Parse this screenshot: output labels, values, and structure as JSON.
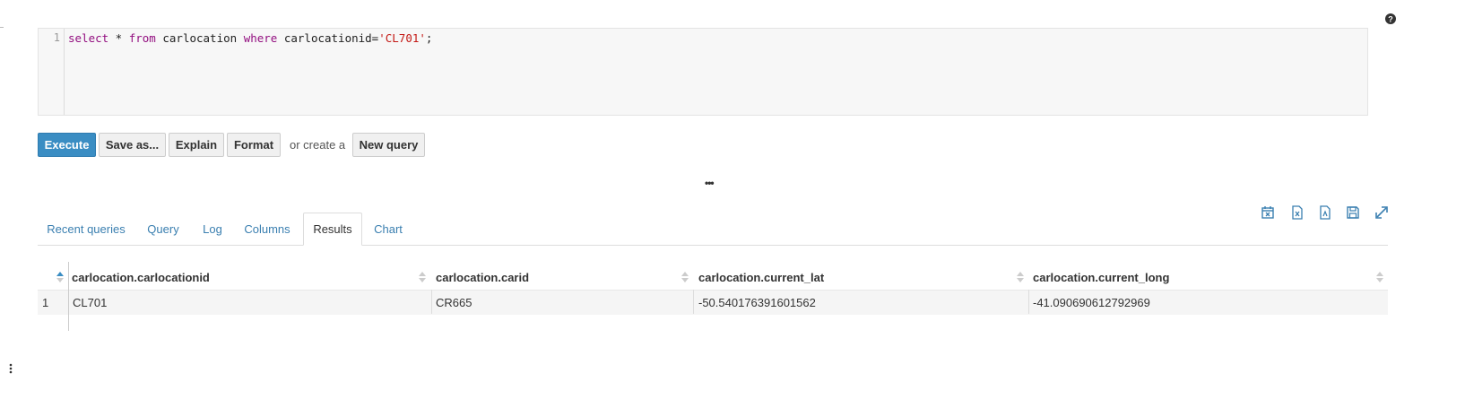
{
  "editor": {
    "line_number": "1",
    "tokens": [
      {
        "t": "select",
        "c": "kw"
      },
      {
        "t": " * ",
        "c": ""
      },
      {
        "t": "from",
        "c": "kw"
      },
      {
        "t": " carlocation ",
        "c": ""
      },
      {
        "t": "where",
        "c": "kw"
      },
      {
        "t": " carlocationid=",
        "c": ""
      },
      {
        "t": "'CL701'",
        "c": "str"
      },
      {
        "t": ";",
        "c": ""
      }
    ]
  },
  "buttons": {
    "execute": "Execute",
    "save_as": "Save as...",
    "explain": "Explain",
    "format": "Format",
    "or_create": "or create a",
    "new_query": "New query"
  },
  "splitter": "•••",
  "tabs": [
    {
      "label": "Recent queries",
      "active": false
    },
    {
      "label": "Query",
      "active": false
    },
    {
      "label": "Log",
      "active": false
    },
    {
      "label": "Columns",
      "active": false
    },
    {
      "label": "Results",
      "active": true
    },
    {
      "label": "Chart",
      "active": false
    }
  ],
  "toolbar_icons": [
    "clear-results-icon",
    "export-excel-icon",
    "export-csv-icon",
    "save-results-icon",
    "fullscreen-icon"
  ],
  "results": {
    "columns": [
      "carlocation.carlocationid",
      "carlocation.carid",
      "carlocation.current_lat",
      "carlocation.current_long"
    ],
    "rows": [
      {
        "num": "1",
        "cells": [
          "CL701",
          "CR665",
          "-50.540176391601562",
          "-41.090690612792969"
        ]
      }
    ]
  },
  "colors": {
    "primary": "#3a8dc3",
    "link": "#3a7fb0",
    "keyword": "#930f80",
    "string": "#c41a16"
  }
}
